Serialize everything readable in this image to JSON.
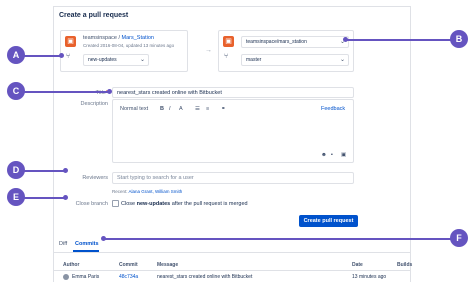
{
  "page_title": "Create a pull request",
  "source": {
    "workspace": "teamsinspace",
    "separator": "/",
    "repo": "Mars_Station",
    "meta": "Created 2016-08-04, updated 13 minutes ago",
    "branch": "new-updates"
  },
  "destination": {
    "repo": "teamsinspace/mars_station",
    "branch": "master"
  },
  "form": {
    "title_label": "Title",
    "title_required": "*",
    "title_value": "nearest_stars created online with Bitbucket",
    "description_label": "Description",
    "editor_toolbar": {
      "format": "Normal text",
      "bold": "B",
      "italic": "I",
      "more": "A",
      "link": "⚭",
      "feedback": "Feedback"
    },
    "reviewers_label": "Reviewers",
    "reviewers_placeholder": "Start typing to search for a user",
    "recent_label": "Recent:",
    "recent_users": "Alana Grant, William Smith",
    "close_branch_label": "Close branch",
    "close_branch_text_prefix": "Close ",
    "close_branch_text_branch": "new-updates",
    "close_branch_text_suffix": " after the pull request is merged",
    "submit_label": "Create pull request"
  },
  "tabs": [
    "Diff",
    "Commits"
  ],
  "table": {
    "headers": [
      "Author",
      "Commit",
      "Message",
      "Date",
      "Builds"
    ],
    "rows": [
      {
        "author": "Emma Paris",
        "commit": "48c734a",
        "message": "nearest_stars created online with Bitbucket",
        "date": "13 minutes ago",
        "builds": ""
      }
    ]
  },
  "callouts": [
    "A",
    "B",
    "C",
    "D",
    "E",
    "F"
  ],
  "colors": {
    "accent": "#0052cc",
    "callout": "#6554c0",
    "repo_icon": "#e8612c"
  }
}
